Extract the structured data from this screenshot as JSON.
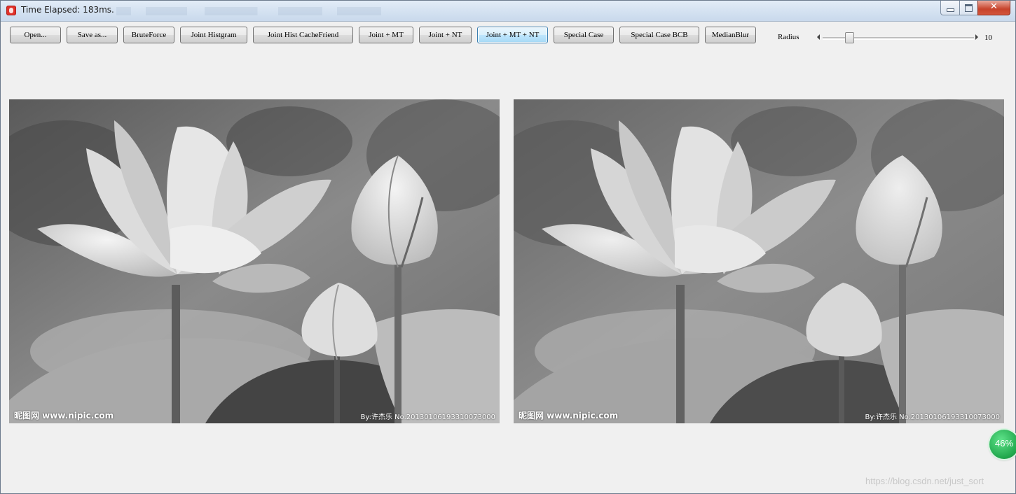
{
  "window": {
    "title": "Time Elapsed: 183ms.",
    "close_glyph": "✕"
  },
  "toolbar": {
    "buttons": [
      {
        "label": "Open..."
      },
      {
        "label": "Save as..."
      },
      {
        "label": "BruteForce"
      },
      {
        "label": "Joint Histgram"
      },
      {
        "label": "Joint Hist CacheFriend"
      },
      {
        "label": "Joint + MT"
      },
      {
        "label": "Joint + NT"
      },
      {
        "label": "Joint + MT + NT"
      },
      {
        "label": "Special Case"
      },
      {
        "label": "Special Case BCB"
      },
      {
        "label": "MedianBlur"
      }
    ],
    "radius_label": "Radius",
    "radius_value": "10",
    "radius_slider_fraction": 0.16
  },
  "images": {
    "original_watermark_left": "昵图网 www.nipic.com",
    "original_watermark_right": "By:许杰乐  No.20130106193310073000",
    "filtered_watermark_left": "昵图网 www.nipic.com",
    "filtered_watermark_right": "By:许杰乐  No.20130106193310073000"
  },
  "overlay": {
    "progress_badge": "46%",
    "source_watermark": "https://blog.csdn.net/just_sort"
  }
}
